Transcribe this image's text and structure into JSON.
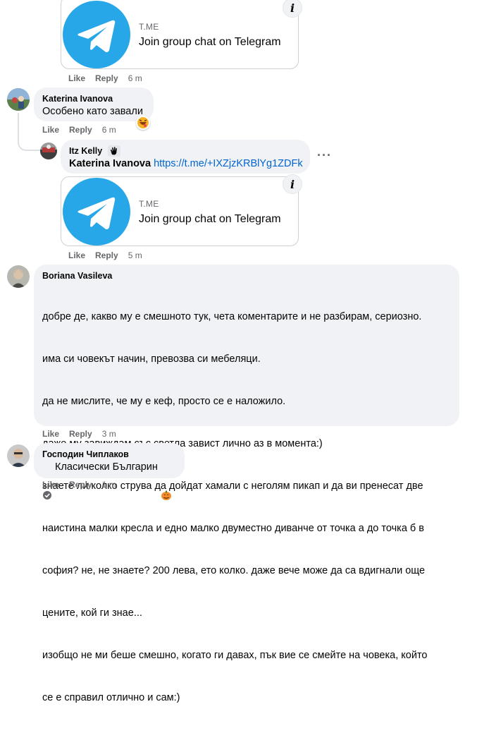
{
  "link_cards": [
    {
      "domain": "T.ME",
      "title": "Join group chat on Telegram"
    },
    {
      "domain": "T.ME",
      "title": "Join group chat on Telegram"
    }
  ],
  "actions": {
    "like": "Like",
    "reply": "Reply"
  },
  "comments": {
    "c0": {
      "time": "6 m"
    },
    "c1": {
      "author": "Katerina Ivanova",
      "text": "Особено като завали",
      "time": "6 m"
    },
    "c2": {
      "author": "Itz Kelly",
      "mention": "Katerina Ivanova",
      "url": "https://t.me/+IXZjzKRBlYg1ZDFk",
      "time": "5 m"
    },
    "c3": {
      "author": "Boriana Vasileva",
      "lines": [
        "добре де, какво му е смешното тук, чета коментарите и не разбирам, сериозно.",
        "има си човекът начин, превозва си мебеляци.",
        "да не мислите, че му е кеф, просто се е наложило.",
        "даже му завиждам със светла завист лично аз в момента:)",
        "знаете ли колко струва да дойдат хамали с неголям пикап и да ви пренесат две",
        "наистина малки кресла и едно малко двуместно диванче от точка а до точка б в",
        "софия? не, не знаете? 200 лева, ето колко. даже вече може да са вдигнали още",
        "цените, кой ги знае...",
        "изобщо не ми беше смешно, когато ги давах, пък вие се смейте на човека, който",
        "се е справил отлично и сам:)"
      ],
      "time": "3 m"
    },
    "c4": {
      "author": "Господин Чиплаков",
      "text": "Класически Българин",
      "time": "1 m"
    }
  },
  "colors": {
    "telegram": "#27a7e7",
    "bubble": "#f0f2f5",
    "link": "#0064d1",
    "muted": "#65676b"
  },
  "icons": [
    "telegram-logo-icon",
    "info-icon",
    "more-dots-icon",
    "haha-reaction-icon",
    "waving-hand-icon",
    "verified-badge-icon",
    "pumpkin-icon"
  ]
}
